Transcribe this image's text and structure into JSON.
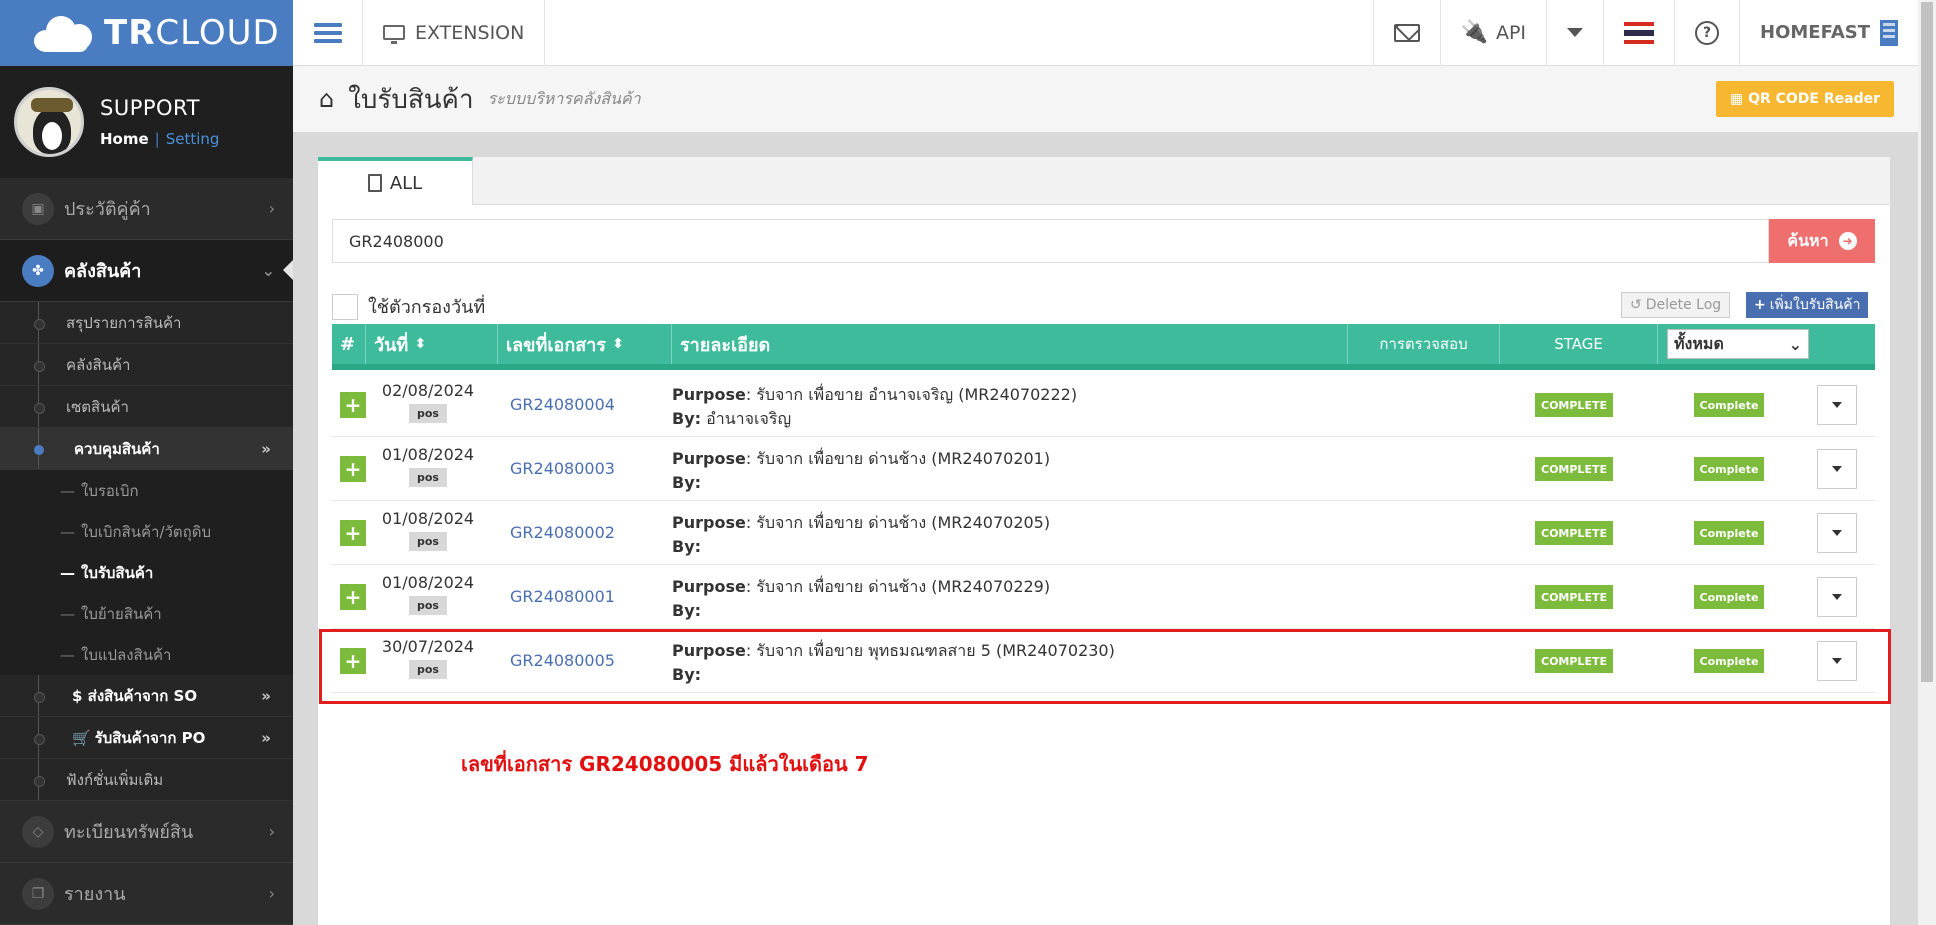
{
  "brand": {
    "logo_tr": "TR",
    "logo_cloud": "CLOUD",
    "color": "#4a7cc1"
  },
  "user": {
    "name": "SUPPORT",
    "home": "Home",
    "sep": "|",
    "setting": "Setting"
  },
  "sidebar": {
    "items": [
      {
        "label": "ประวัติคู่ค้า",
        "icon": "contacts-icon"
      },
      {
        "label": "คลังสินค้า",
        "icon": "boxes-icon",
        "active": true
      }
    ],
    "sub_items": [
      "สรุปรายการสินค้า",
      "คลังสินค้า",
      "เซตสินค้า"
    ],
    "open_group": "ควบคุมสินค้า",
    "open_children": [
      "ใบรอเบิก",
      "ใบเบิกสินค้า/วัตถุดิบ",
      "ใบรับสินค้า",
      "ใบย้ายสินค้า",
      "ใบแปลงสินค้า"
    ],
    "after_groups": [
      "$ ส่งสินค้าจาก SO",
      "รับสินค้าจาก PO",
      "ฟังก์ชั่นเพิ่มเติม"
    ],
    "bottom_items": [
      {
        "label": "ทะเบียนทรัพย์สิน",
        "icon": "diamond-icon"
      },
      {
        "label": "รายงาน",
        "icon": "report-icon"
      }
    ]
  },
  "topbar": {
    "extension": "EXTENSION",
    "api": "API",
    "company": "HOMEFAST",
    "help": "?"
  },
  "page": {
    "title": "ใบรับสินค้า",
    "subtitle": "ระบบบริหารคลังสินค้า",
    "qr_button": "QR CODE Reader"
  },
  "tabs": {
    "all": "ALL"
  },
  "search": {
    "value": "GR2408000",
    "button": "ค้นหา"
  },
  "filter": {
    "label": "ใช้ตัวกรองวันที่"
  },
  "actions": {
    "delete_log": "Delete Log",
    "add": "เพิ่มใบรับสินค้า"
  },
  "table": {
    "headers": {
      "num": "#",
      "date": "วันที่",
      "doc": "เลขที่เอกสาร",
      "detail": "รายละเอียด",
      "check": "การตรวจสอบ",
      "stage": "STAGE",
      "filter": "ทั้งหมด"
    },
    "purpose_label": "Purpose",
    "by_label": "By:",
    "rows": [
      {
        "date": "02/08/2024",
        "tag": "pos",
        "doc": "GR24080004",
        "purpose": ": รับจาก เพื่อขาย อำนาจเจริญ (MR24070222)",
        "by": "อำนาจเจริญ",
        "check": "COMPLETE",
        "stage": "Complete"
      },
      {
        "date": "01/08/2024",
        "tag": "pos",
        "doc": "GR24080003",
        "purpose": ": รับจาก เพื่อขาย ด่านช้าง (MR24070201)",
        "by": "",
        "check": "COMPLETE",
        "stage": "Complete"
      },
      {
        "date": "01/08/2024",
        "tag": "pos",
        "doc": "GR24080002",
        "purpose": ": รับจาก เพื่อขาย ด่านช้าง (MR24070205)",
        "by": "",
        "check": "COMPLETE",
        "stage": "Complete"
      },
      {
        "date": "01/08/2024",
        "tag": "pos",
        "doc": "GR24080001",
        "purpose": ": รับจาก เพื่อขาย ด่านช้าง (MR24070229)",
        "by": "",
        "check": "COMPLETE",
        "stage": "Complete"
      },
      {
        "date": "30/07/2024",
        "tag": "pos",
        "doc": "GR24080005",
        "purpose": ": รับจาก เพื่อขาย พุทธมณฑลสาย 5 (MR24070230)",
        "by": "",
        "check": "COMPLETE",
        "stage": "Complete"
      }
    ]
  },
  "annotation": {
    "note": "เลขที่เอกสาร GR24080005 มีแล้วในเดือน 7",
    "color": "#e01e1e"
  }
}
